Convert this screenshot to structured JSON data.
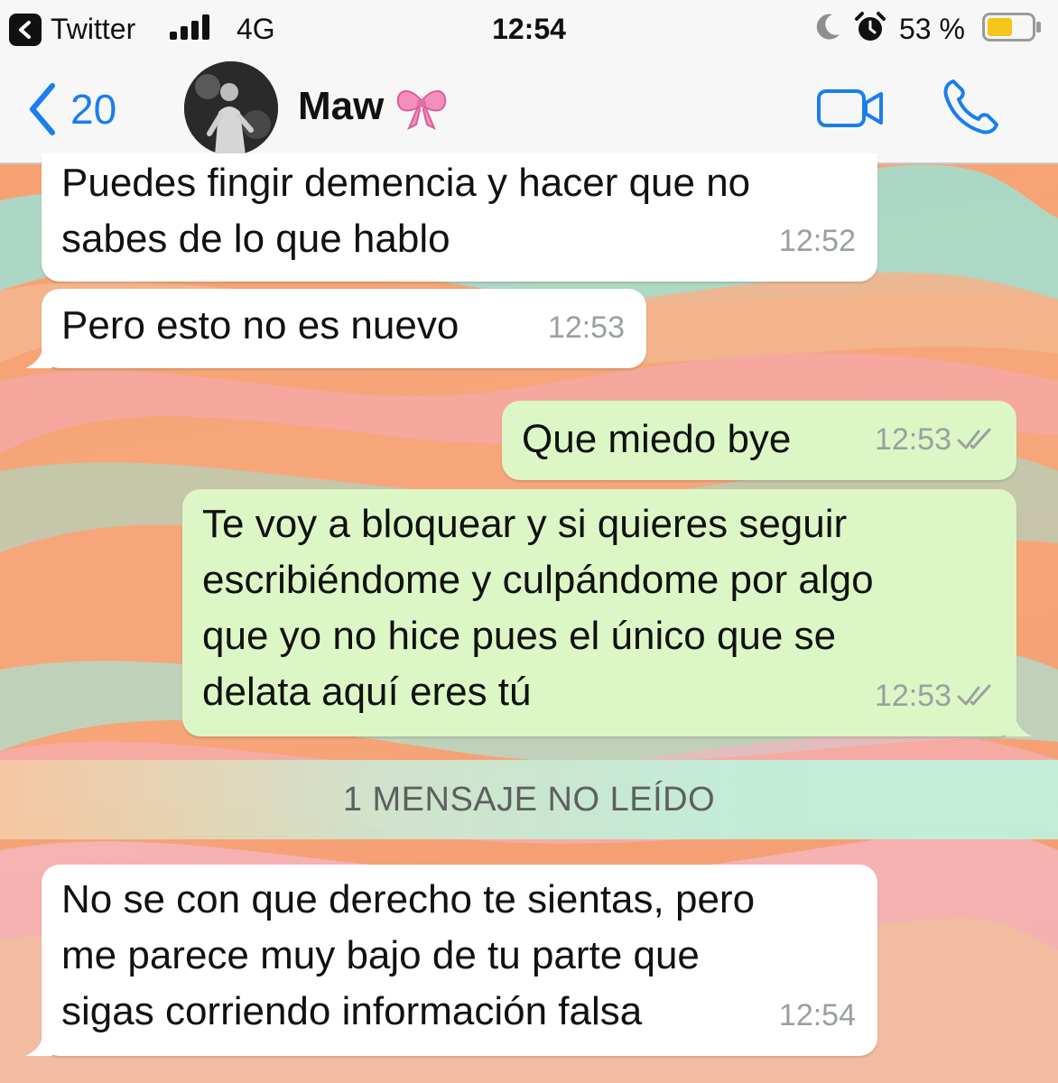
{
  "status_bar": {
    "back_app_label": "Twitter",
    "network": "4G",
    "time": "12:54",
    "battery_percent": "53 %"
  },
  "header": {
    "back_count": "20",
    "contact_name": "Maw"
  },
  "messages": [
    {
      "direction": "incoming",
      "text": "Puedes fingir demencia y hacer que no\nsabes de lo que hablo",
      "time": "12:52"
    },
    {
      "direction": "incoming",
      "text": "Pero esto no es nuevo",
      "time": "12:53"
    },
    {
      "direction": "outgoing",
      "text": "Que miedo bye",
      "time": "12:53",
      "status": "read"
    },
    {
      "direction": "outgoing",
      "text": "Te voy a bloquear y si quieres seguir\nescribiéndome y culpándome por algo\nque yo no hice pues el único que se\ndelata aquí eres tú",
      "time": "12:53",
      "status": "read"
    },
    {
      "direction": "incoming",
      "text": "No se con que derecho te sientas, pero\nme parece muy bajo de tu parte que\nsigas corriendo información falsa",
      "time": "12:54"
    }
  ],
  "unread_banner": "1 MENSAJE NO LEÍDO",
  "colors": {
    "accent": "#1a7ef0",
    "incoming_bubble": "#ffffff",
    "outgoing_bubble": "#dcf7c5",
    "battery_fill": "#f5c518"
  },
  "icons": [
    "app-back-icon",
    "signal-icon",
    "moon-icon",
    "alarm-icon",
    "battery-icon",
    "chevron-left-icon",
    "bow-icon",
    "video-camera-icon",
    "phone-icon",
    "double-check-icon"
  ]
}
